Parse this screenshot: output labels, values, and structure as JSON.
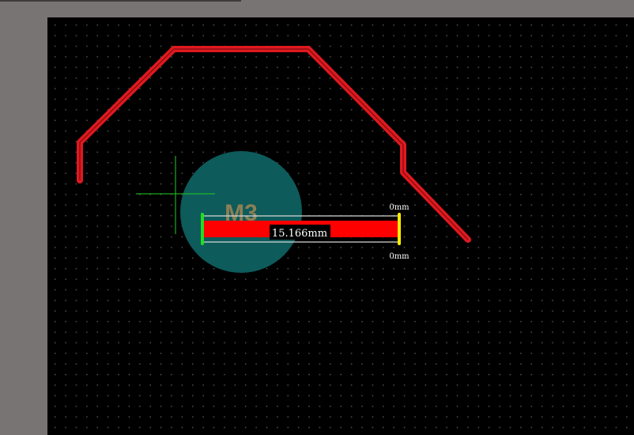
{
  "workspace": {
    "canvas_background": "#000000",
    "frame_background": "#787473",
    "grid_dot_color": "#4a4a4a"
  },
  "board_outline": {
    "color": "#e0191f"
  },
  "mounting_hole": {
    "label": "M3",
    "fill_color": "#0d5b5a",
    "label_color": "#8c7f55"
  },
  "track": {
    "length_label": "15.166mm",
    "fill_color": "#ff0000",
    "start_handle_color": "#22dd22",
    "end_handle_color": "#ffee00",
    "top_offset_label": "0mm",
    "bottom_offset_label": "0mm"
  },
  "cursor": {
    "color": "#22cc22",
    "icon": "crosshair-icon"
  }
}
